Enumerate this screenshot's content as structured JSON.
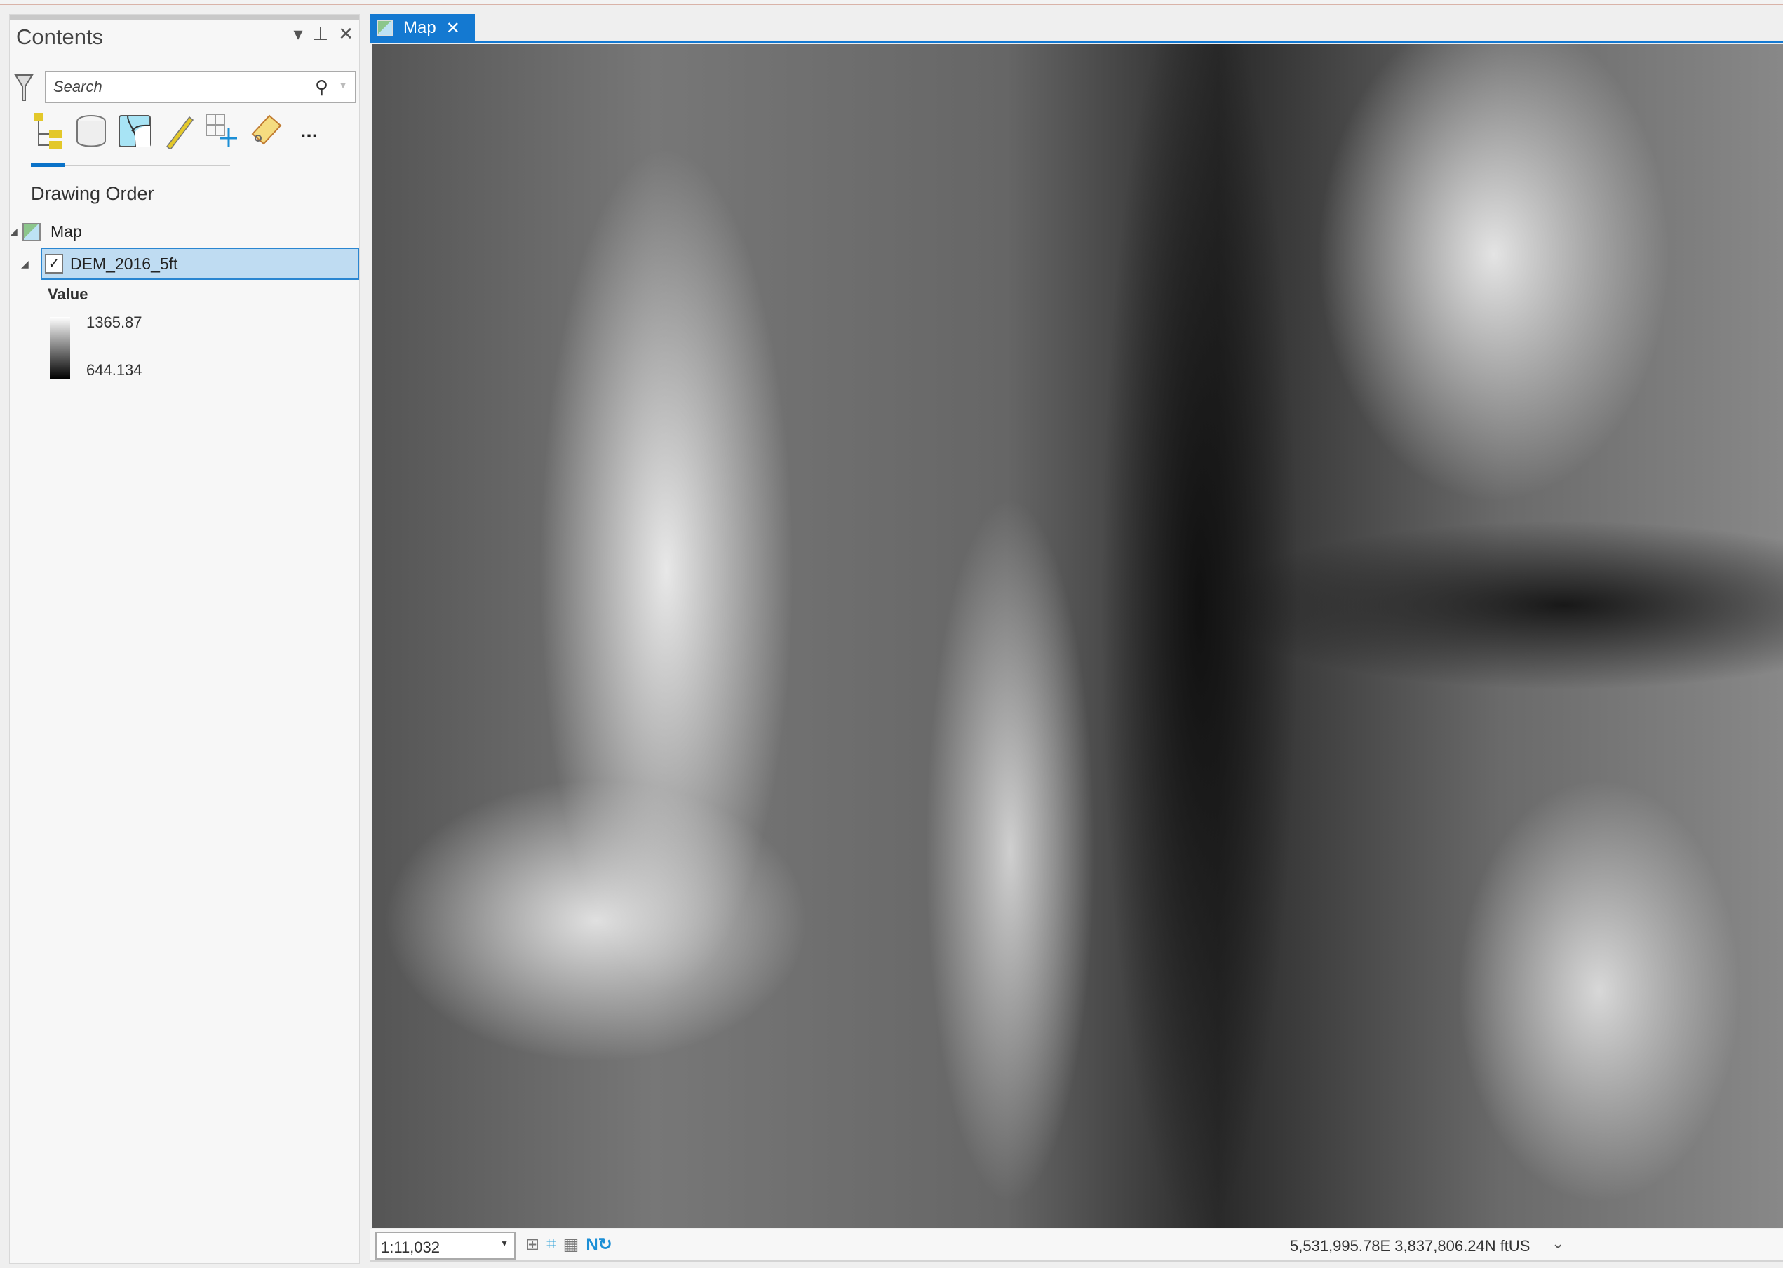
{
  "contents": {
    "title": "Contents",
    "search_placeholder": "Search",
    "section": "Drawing Order",
    "map_item": "Map",
    "layer": "DEM_2016_5ft",
    "legend_title": "Value",
    "legend_high": "1365.87",
    "legend_low": "644.134",
    "more": "..."
  },
  "tab": {
    "label": "Map",
    "close": "✕"
  },
  "status": {
    "scale": "1:11,032",
    "coordinates": "5,531,995.78E 3,837,806.24N ftUS"
  },
  "colors": {
    "accent": "#1479d1",
    "selection": "#bfdcf2"
  }
}
